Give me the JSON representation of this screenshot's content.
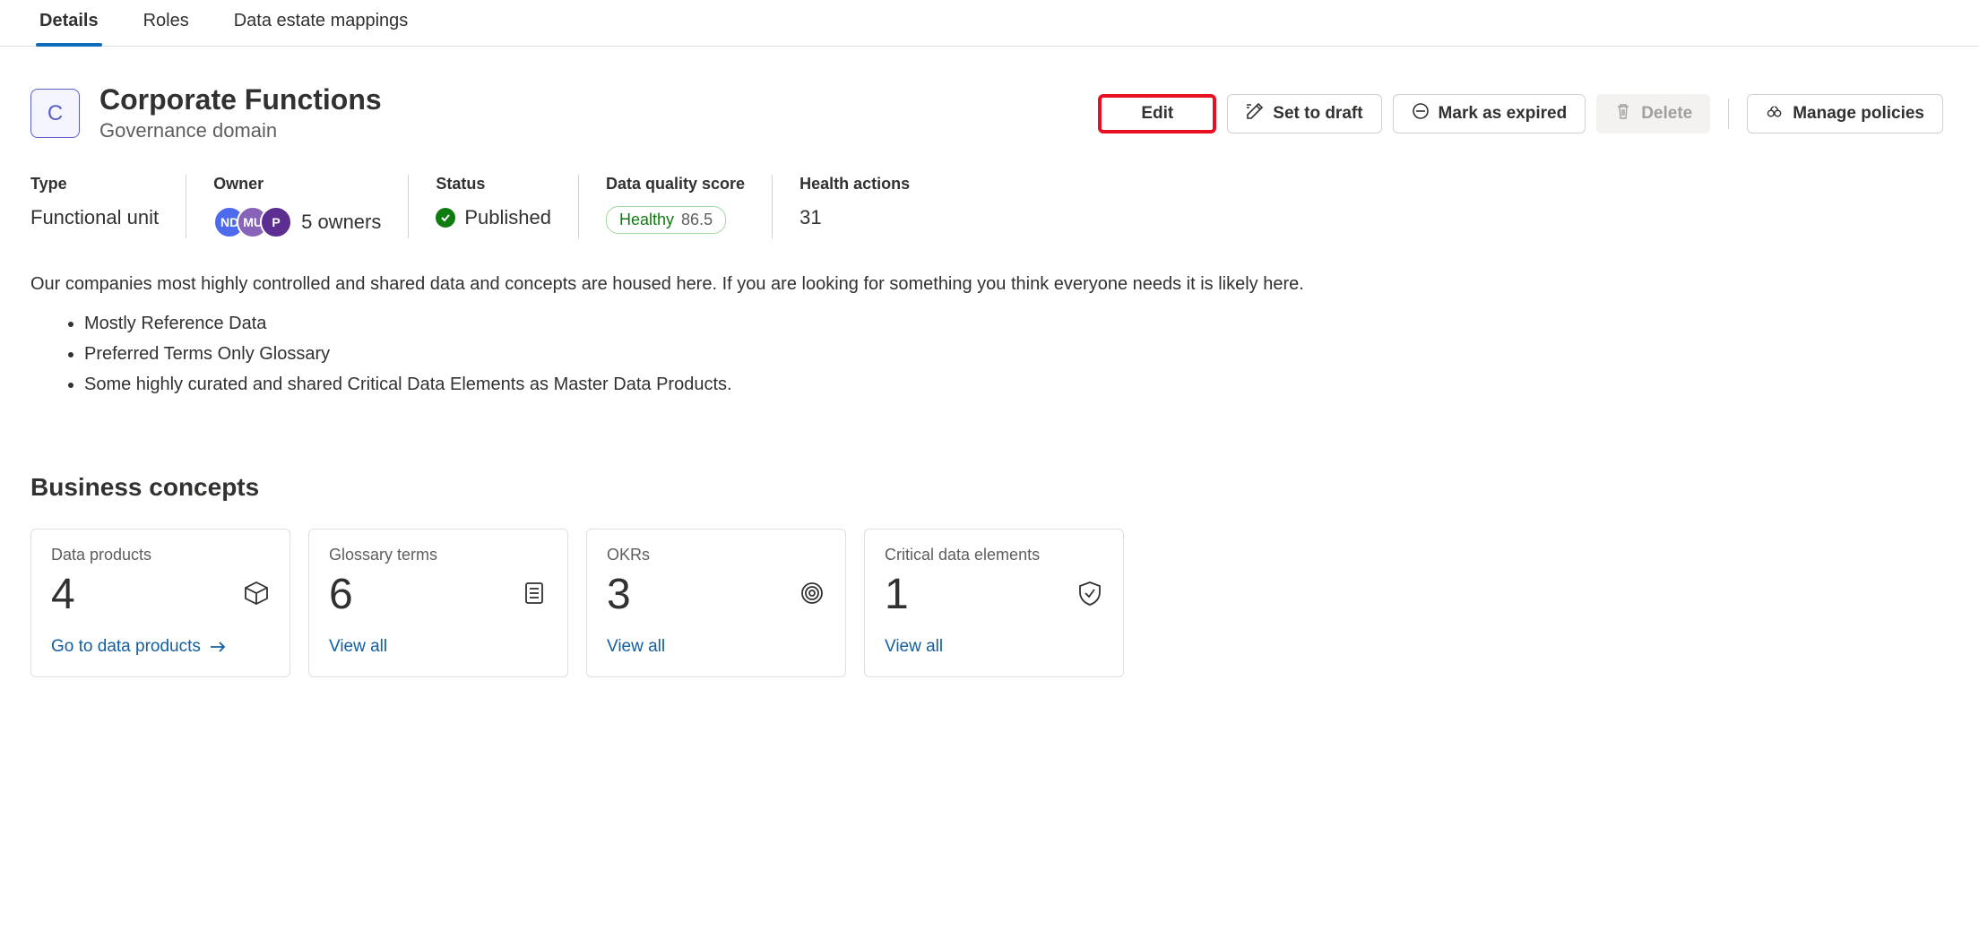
{
  "tabs": {
    "details": "Details",
    "roles": "Roles",
    "mappings": "Data estate mappings"
  },
  "header": {
    "initial": "C",
    "title": "Corporate Functions",
    "subtitle": "Governance domain"
  },
  "actions": {
    "edit": "Edit",
    "draft": "Set to draft",
    "expired": "Mark as expired",
    "delete": "Delete",
    "policies": "Manage policies"
  },
  "props": {
    "type": {
      "label": "Type",
      "value": "Functional unit"
    },
    "owner": {
      "label": "Owner",
      "avatars": [
        "ND",
        "MU",
        "P"
      ],
      "count": "5 owners"
    },
    "status": {
      "label": "Status",
      "value": "Published"
    },
    "dq": {
      "label": "Data quality score",
      "badge": "Healthy",
      "score": "86.5"
    },
    "health": {
      "label": "Health actions",
      "value": "31"
    }
  },
  "description": {
    "text": "Our companies most highly controlled and shared data and concepts are housed here. If you are looking for something you think everyone needs it is likely here.",
    "bullets": [
      "Mostly Reference Data",
      "Preferred Terms Only Glossary",
      "Some highly curated and shared Critical Data Elements as Master Data Products."
    ]
  },
  "section": {
    "title": "Business concepts"
  },
  "cards": {
    "dp": {
      "label": "Data products",
      "count": "4",
      "link": "Go to data products"
    },
    "gt": {
      "label": "Glossary terms",
      "count": "6",
      "link": "View all"
    },
    "ok": {
      "label": "OKRs",
      "count": "3",
      "link": "View all"
    },
    "cde": {
      "label": "Critical data elements",
      "count": "1",
      "link": "View all"
    }
  }
}
